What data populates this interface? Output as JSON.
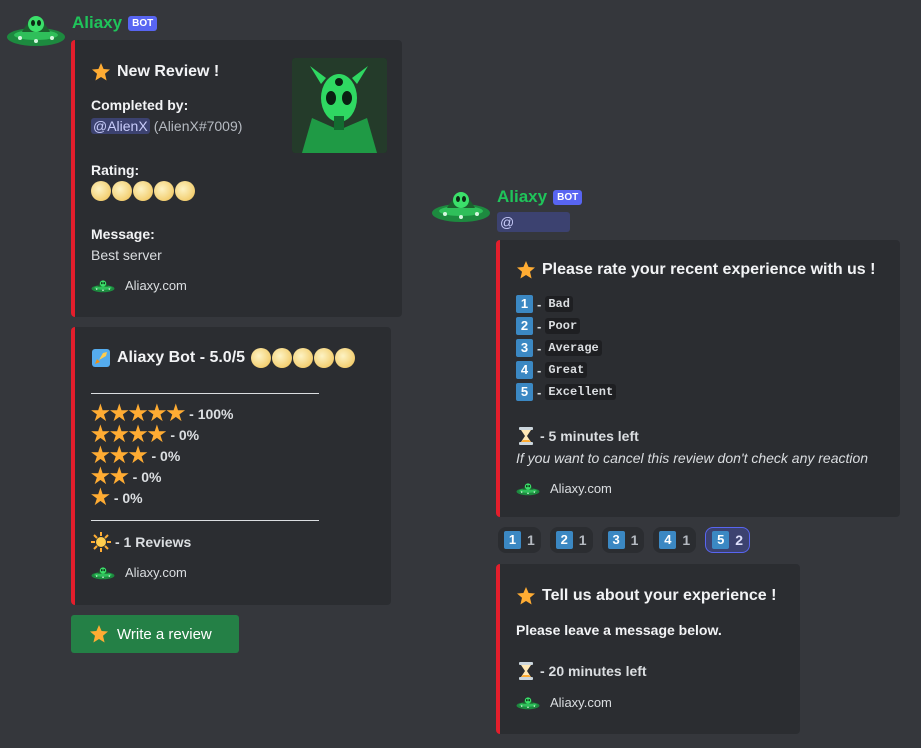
{
  "message1": {
    "author": "Aliaxy",
    "tag": "BOT"
  },
  "embed_review": {
    "title": "New Review !",
    "completed_label": "Completed by:",
    "mention": "@AlienX",
    "user_tag": "(AlienX#7009)",
    "rating_label": "Rating:",
    "rating_coins": 5,
    "message_label": "Message:",
    "message_text": "Best server",
    "footer": "Aliaxy.com"
  },
  "embed_summary": {
    "title": "Aliaxy Bot - 5.0/5",
    "rating_coins": 5,
    "rows": [
      {
        "stars": 5,
        "label": "- 100%"
      },
      {
        "stars": 4,
        "label": "- 0%"
      },
      {
        "stars": 3,
        "label": "- 0%"
      },
      {
        "stars": 2,
        "label": "- 0%"
      },
      {
        "stars": 1,
        "label": "- 0%"
      }
    ],
    "reviews": "- 1 Reviews",
    "footer": "Aliaxy.com"
  },
  "write_button": "Write a review",
  "message2": {
    "author": "Aliaxy",
    "tag": "BOT",
    "mention": "@"
  },
  "embed_rate": {
    "title": "Please rate your recent experience with us !",
    "options": [
      {
        "num": "1",
        "label": "Bad"
      },
      {
        "num": "2",
        "label": "Poor"
      },
      {
        "num": "3",
        "label": "Average"
      },
      {
        "num": "4",
        "label": "Great"
      },
      {
        "num": "5",
        "label": "Excellent"
      }
    ],
    "timer": "- 5 minutes left",
    "note": "If you want to cancel this review don't check any reaction",
    "footer": "Aliaxy.com"
  },
  "reactions": [
    {
      "emoji": "1",
      "count": "1",
      "selected": false
    },
    {
      "emoji": "2",
      "count": "1",
      "selected": false
    },
    {
      "emoji": "3",
      "count": "1",
      "selected": false
    },
    {
      "emoji": "4",
      "count": "1",
      "selected": false
    },
    {
      "emoji": "5",
      "count": "2",
      "selected": true
    }
  ],
  "embed_tell": {
    "title": "Tell us about your experience !",
    "subtitle": "Please leave a message below.",
    "timer": "- 20 minutes left",
    "footer": "Aliaxy.com"
  },
  "icons": {
    "avatar": "ufo-alien-icon",
    "star": "star-icon",
    "coin": "rating-coin-icon",
    "rocket": "rocket-icon",
    "sun": "sun-icon",
    "hourglass": "hourglass-icon"
  },
  "colors": {
    "background": "#35373c",
    "embed_bg": "#2b2d31",
    "embed_bar": "#e31e2c",
    "bot_name": "#1fc45a",
    "bot_tag": "#5865f2",
    "button": "#248046",
    "keycap": "#3b88c3"
  }
}
